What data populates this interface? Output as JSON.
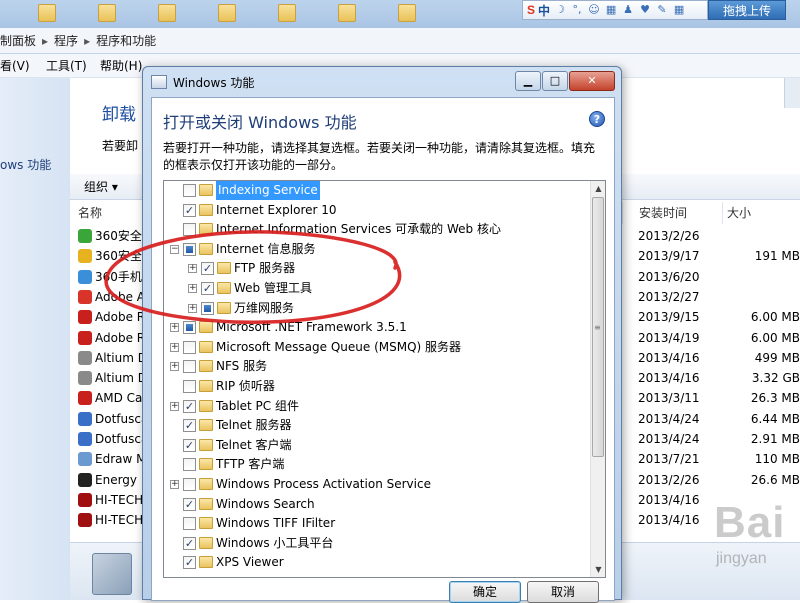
{
  "top_toolbar": {
    "ime_logo": "S",
    "ime_lang": "中",
    "share_button": "拖拽上传"
  },
  "breadcrumb": [
    "制面板",
    "程序",
    "程序和功能"
  ],
  "menubar": [
    "看(V)",
    "工具(T)",
    "帮助(H)"
  ],
  "left_pane": {
    "link": "ows 功能"
  },
  "content": {
    "title": "卸载",
    "desc": "若要卸",
    "organize": "组织 ▾"
  },
  "program_list": {
    "headers": {
      "name": "名称",
      "installed": "安装时间",
      "size": "大小"
    },
    "rows": [
      {
        "name": "360安全",
        "date": "2013/2/26",
        "size": "",
        "color": "#3aa63a"
      },
      {
        "name": "360安全",
        "date": "2013/9/17",
        "size": "191 MB",
        "color": "#e6b220"
      },
      {
        "name": "360手机",
        "date": "2013/6/20",
        "size": "",
        "color": "#3a8fd8"
      },
      {
        "name": "Adobe A",
        "date": "2013/2/27",
        "size": "",
        "color": "#d8342a"
      },
      {
        "name": "Adobe R",
        "date": "2013/9/15",
        "size": "6.00 MB",
        "color": "#c8201c"
      },
      {
        "name": "Adobe R",
        "date": "2013/4/19",
        "size": "6.00 MB",
        "color": "#c8201c"
      },
      {
        "name": "Altium D",
        "date": "2013/4/16",
        "size": "499 MB",
        "color": "#8a8a8a"
      },
      {
        "name": "Altium D",
        "date": "2013/4/16",
        "size": "3.32 GB",
        "color": "#8a8a8a"
      },
      {
        "name": "AMD Ca",
        "date": "2013/3/11",
        "size": "26.3 MB",
        "color": "#c8201c"
      },
      {
        "name": "Dotfusca",
        "date": "2013/4/24",
        "size": "6.44 MB",
        "color": "#3a6fc8"
      },
      {
        "name": "Dotfusca",
        "date": "2013/4/24",
        "size": "2.91 MB",
        "color": "#3a6fc8"
      },
      {
        "name": "Edraw M",
        "date": "2013/7/21",
        "size": "110 MB",
        "color": "#6a9ad0"
      },
      {
        "name": "Energy I",
        "date": "2013/2/26",
        "size": "26.6 MB",
        "color": "#222222"
      },
      {
        "name": "HI-TECH",
        "date": "2013/4/16",
        "size": "",
        "color": "#a01010"
      },
      {
        "name": "HI-TECH",
        "date": "2013/4/16",
        "size": "",
        "color": "#a01010"
      }
    ]
  },
  "watermark": {
    "main": "Bai",
    "sub": "jingyan"
  },
  "dialog": {
    "window_title": "Windows 功能",
    "heading": "打开或关闭 Windows 功能",
    "help": "?",
    "description": "若要打开一种功能，请选择其复选框。若要关闭一种功能，请清除其复选框。填充的框表示仅打开该功能的一部分。",
    "ok_label": "确定",
    "cancel_label": "取消",
    "features": [
      {
        "label": "Indexing Service",
        "level": 0,
        "state": "unchecked",
        "expander": "",
        "selected": true
      },
      {
        "label": "Internet Explorer 10",
        "level": 0,
        "state": "checked",
        "expander": ""
      },
      {
        "label": "Internet Information Services 可承载的 Web 核心",
        "level": 0,
        "state": "unchecked",
        "expander": ""
      },
      {
        "label": "Internet 信息服务",
        "level": 0,
        "state": "partial",
        "expander": "−"
      },
      {
        "label": "FTP 服务器",
        "level": 1,
        "state": "checked",
        "expander": "+"
      },
      {
        "label": "Web 管理工具",
        "level": 1,
        "state": "checked",
        "expander": "+"
      },
      {
        "label": "万维网服务",
        "level": 1,
        "state": "partial",
        "expander": "+"
      },
      {
        "label": "Microsoft .NET Framework 3.5.1",
        "level": 0,
        "state": "partial",
        "expander": "+"
      },
      {
        "label": "Microsoft Message Queue (MSMQ) 服务器",
        "level": 0,
        "state": "unchecked",
        "expander": "+"
      },
      {
        "label": "NFS 服务",
        "level": 0,
        "state": "unchecked",
        "expander": "+"
      },
      {
        "label": "RIP 侦听器",
        "level": 0,
        "state": "unchecked",
        "expander": ""
      },
      {
        "label": "Tablet PC 组件",
        "level": 0,
        "state": "checked",
        "expander": "+"
      },
      {
        "label": "Telnet 服务器",
        "level": 0,
        "state": "checked",
        "expander": ""
      },
      {
        "label": "Telnet 客户端",
        "level": 0,
        "state": "checked",
        "expander": ""
      },
      {
        "label": "TFTP 客户端",
        "level": 0,
        "state": "unchecked",
        "expander": ""
      },
      {
        "label": "Windows Process Activation Service",
        "level": 0,
        "state": "unchecked",
        "expander": "+"
      },
      {
        "label": "Windows Search",
        "level": 0,
        "state": "checked",
        "expander": ""
      },
      {
        "label": "Windows TIFF IFilter",
        "level": 0,
        "state": "unchecked",
        "expander": ""
      },
      {
        "label": "Windows 小工具平台",
        "level": 0,
        "state": "checked",
        "expander": ""
      },
      {
        "label": "XPS Viewer",
        "level": 0,
        "state": "checked",
        "expander": ""
      }
    ]
  },
  "colors": {
    "highlight_ellipse": "#d81e1e",
    "selection": "#3399ff"
  }
}
